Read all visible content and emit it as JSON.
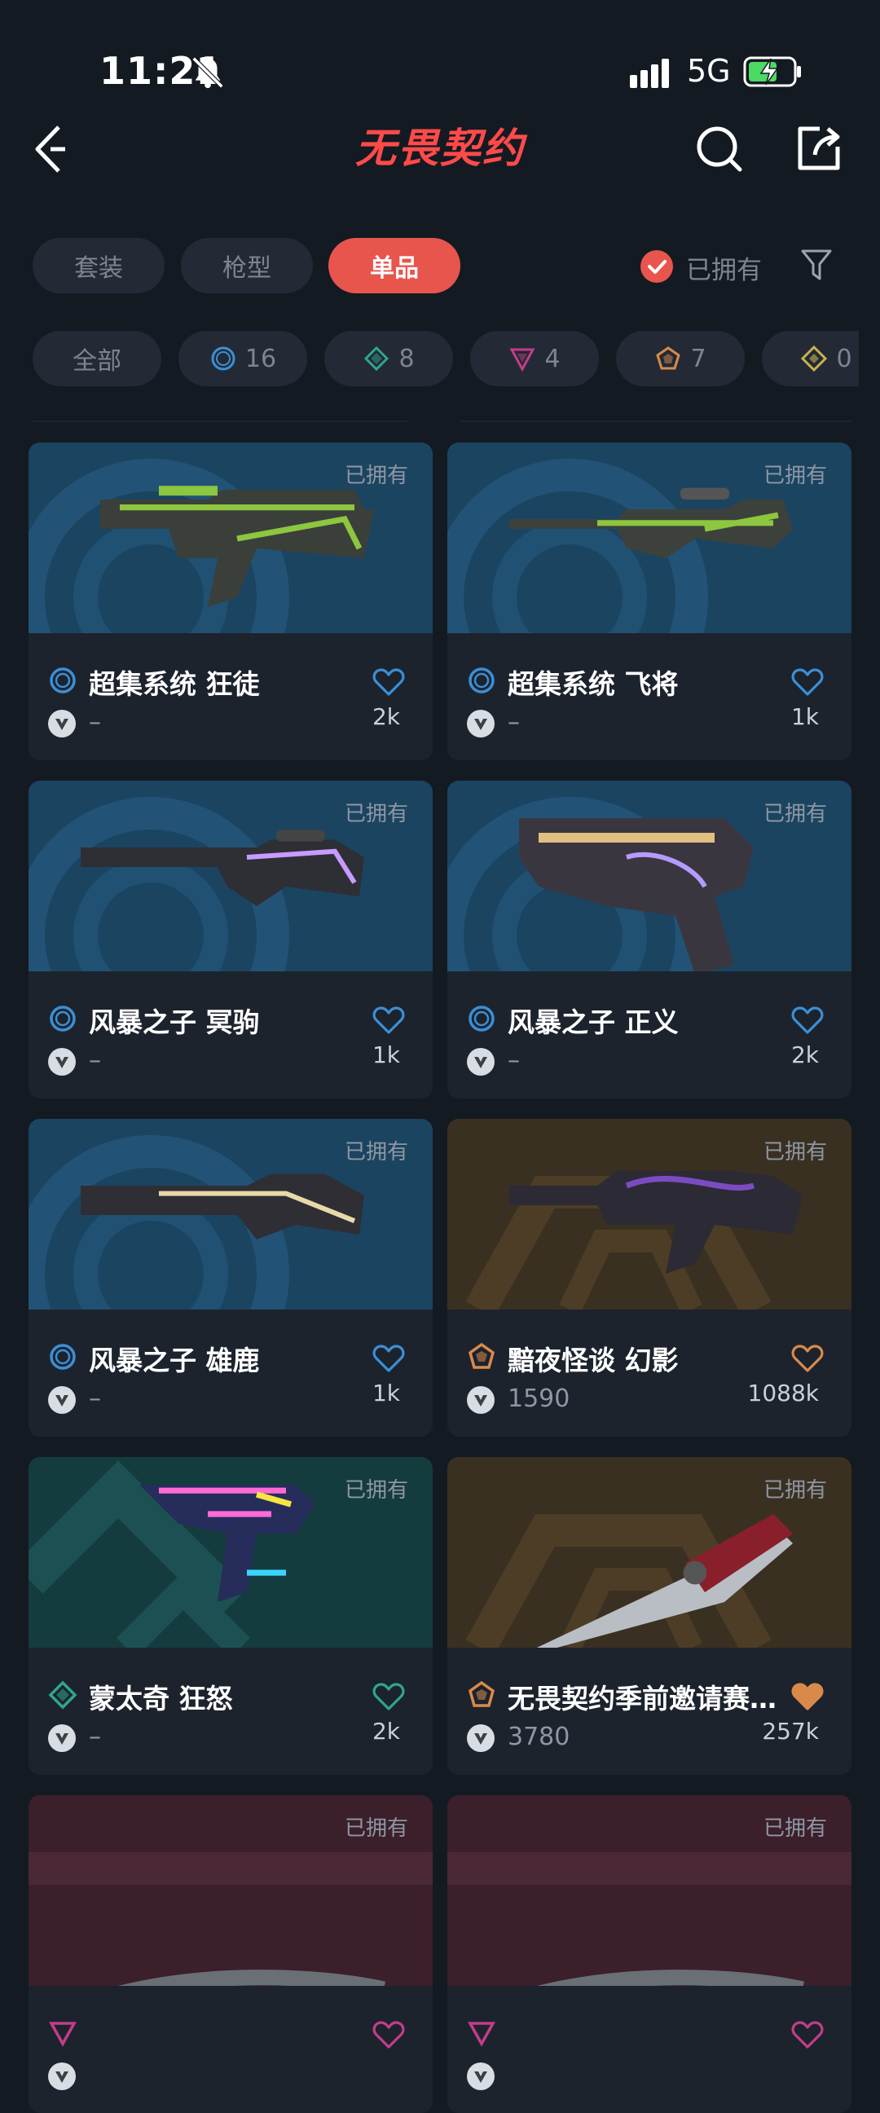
{
  "status_bar": {
    "time": "11:21",
    "network": "5G"
  },
  "header": {
    "title": "无畏契约"
  },
  "tabs": [
    {
      "label": "套装",
      "active": false
    },
    {
      "label": "枪型",
      "active": false
    },
    {
      "label": "单品",
      "active": true
    }
  ],
  "owned_filter": {
    "label": "已拥有",
    "checked": true
  },
  "rarity_chips": [
    {
      "label": "全部"
    },
    {
      "count": "16",
      "tier": "select",
      "color": "#3b8fd6"
    },
    {
      "count": "8",
      "tier": "deluxe",
      "color": "#2fa58f"
    },
    {
      "count": "4",
      "tier": "premium",
      "color": "#c23d8a"
    },
    {
      "count": "7",
      "tier": "exclusive",
      "color": "#d98a4b"
    },
    {
      "count": "0",
      "tier": "ultra",
      "color": "#c9b24c"
    }
  ],
  "cards": [
    {
      "owned": "已拥有",
      "name": "超集系统 狂徒",
      "price": "–",
      "likes": "2k",
      "tier": "select",
      "color": "#3b8fd6",
      "liked": false,
      "weapon": "rifle-green"
    },
    {
      "owned": "已拥有",
      "name": "超集系统 飞将",
      "price": "–",
      "likes": "1k",
      "tier": "select",
      "color": "#3b8fd6",
      "liked": false,
      "weapon": "sniper-green"
    },
    {
      "owned": "已拥有",
      "name": "风暴之子 冥驹",
      "price": "–",
      "likes": "1k",
      "tier": "select",
      "color": "#3b8fd6",
      "liked": false,
      "weapon": "sniper-dark"
    },
    {
      "owned": "已拥有",
      "name": "风暴之子 正义",
      "price": "–",
      "likes": "2k",
      "tier": "select",
      "color": "#3b8fd6",
      "liked": false,
      "weapon": "revolver"
    },
    {
      "owned": "已拥有",
      "name": "风暴之子 雄鹿",
      "price": "–",
      "likes": "1k",
      "tier": "select",
      "color": "#3b8fd6",
      "liked": false,
      "weapon": "shotgun"
    },
    {
      "owned": "已拥有",
      "name": "黯夜怪谈 幻影",
      "price": "1590",
      "likes": "1088k",
      "tier": "exclusive",
      "color": "#d98a4b",
      "liked": false,
      "weapon": "rifle-purple"
    },
    {
      "owned": "已拥有",
      "name": "蒙太奇 狂怒",
      "price": "–",
      "likes": "2k",
      "tier": "deluxe",
      "color": "#2fa58f",
      "liked": false,
      "weapon": "smg-neon"
    },
    {
      "owned": "已拥有",
      "name": "无畏契约季前邀请赛 战刃",
      "price": "3780",
      "likes": "257k",
      "tier": "exclusive",
      "color": "#d98a4b",
      "liked": true,
      "weapon": "knife"
    },
    {
      "owned": "已拥有",
      "name": "",
      "price": "",
      "likes": "",
      "tier": "premium",
      "color": "#c23d8a",
      "liked": false,
      "weapon": "partial"
    },
    {
      "owned": "已拥有",
      "name": "",
      "price": "",
      "likes": "",
      "tier": "premium",
      "color": "#c23d8a",
      "liked": false,
      "weapon": "partial"
    }
  ]
}
